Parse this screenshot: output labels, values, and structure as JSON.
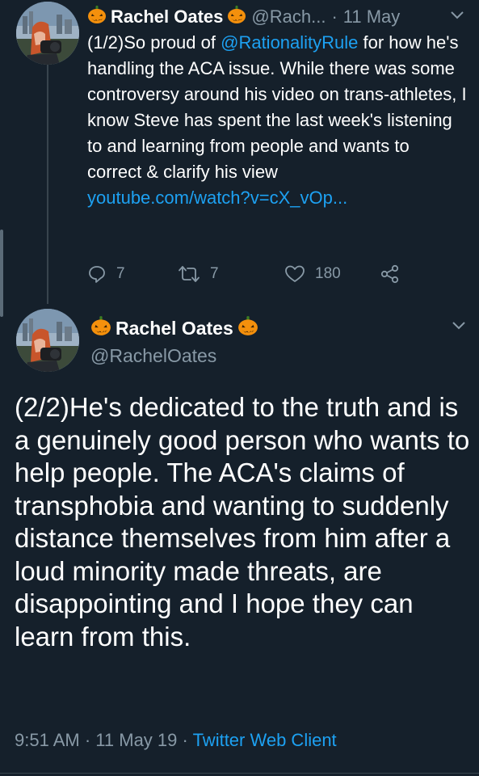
{
  "tweet1": {
    "display_name": "Rachel Oates",
    "handle": "@Rach...",
    "separator": "·",
    "date": "11 May",
    "text_before_mention": "(1/2)So proud of ",
    "mention": "@RationalityRule",
    "text_after_mention": " for how he's handling the ACA issue. While there was some controversy around his video on trans-athletes, I know Steve has spent the last week's listening to and learning from people and wants to correct & clarify his view",
    "link": "youtube.com/watch?v=cX_vOp...",
    "reply_count": "7",
    "retweet_count": "7",
    "like_count": "180"
  },
  "tweet2": {
    "display_name": "Rachel Oates",
    "handle": "@RachelOates",
    "text": "(2/2)He's dedicated to the truth and is a genuinely good person who wants to help people. The ACA's claims of transphobia and wanting to suddenly distance themselves from him after a loud minority made threats, are disappointing and I hope they can learn from this.",
    "time": "9:51 AM",
    "separator1": "·",
    "date": "11 May 19",
    "separator2": "·",
    "client": "Twitter Web Client"
  },
  "icons": {
    "name_emoji": "jack-o-lantern-icon",
    "menu": "chevron-down-icon",
    "reply": "reply-icon",
    "retweet": "retweet-icon",
    "like": "heart-icon",
    "share": "share-icon"
  },
  "colors": {
    "background": "#15202b",
    "text": "#ffffff",
    "muted": "#8899a6",
    "link": "#1da1f2",
    "pumpkin": "#f4900c"
  }
}
